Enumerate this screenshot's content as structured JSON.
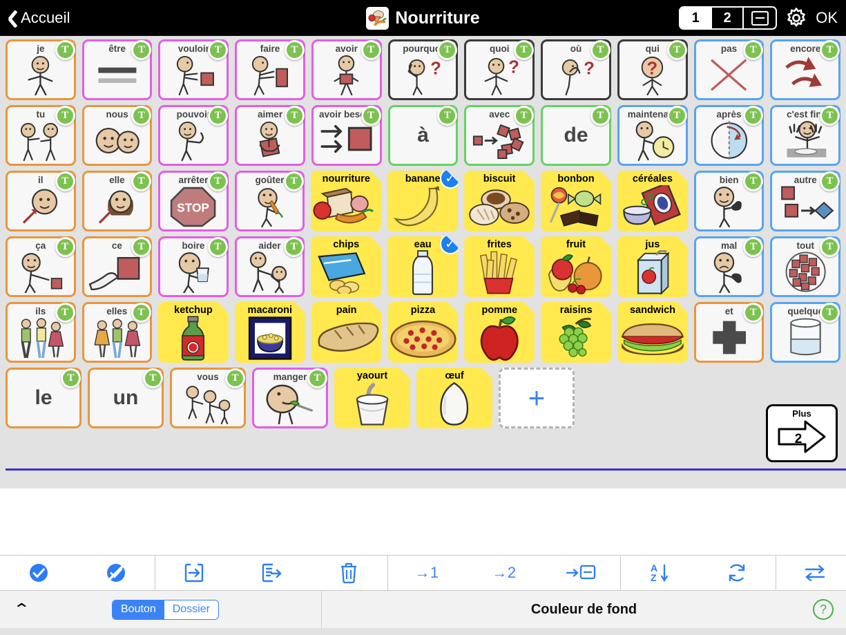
{
  "header": {
    "back_label": "Accueil",
    "title": "Nourriture",
    "title_icon": "food-basket-icon",
    "segments": [
      {
        "label": "1",
        "selected": true
      },
      {
        "label": "2",
        "selected": false
      },
      {
        "label": "tray-icon",
        "selected": false
      }
    ],
    "gear_icon": "gear-icon",
    "ok_label": "OK"
  },
  "grid": {
    "rows": [
      [
        {
          "label": "je",
          "style": "orange",
          "badge": "T",
          "art": "person-pointing-self"
        },
        {
          "label": "être",
          "style": "magenta",
          "badge": "T",
          "art": "equals-bars"
        },
        {
          "label": "vouloir",
          "style": "magenta",
          "badge": "T",
          "art": "person-reaching-square"
        },
        {
          "label": "faire",
          "style": "magenta",
          "badge": "T",
          "art": "person-making-square"
        },
        {
          "label": "avoir",
          "style": "magenta",
          "badge": "T",
          "art": "person-holding-square"
        },
        {
          "label": "pourquoi",
          "style": "dark",
          "badge": "T",
          "art": "person-thinking-question"
        },
        {
          "label": "quoi",
          "style": "dark",
          "badge": "T",
          "art": "person-shrug-question"
        },
        {
          "label": "où",
          "style": "dark",
          "badge": "T",
          "art": "person-looking-question"
        },
        {
          "label": "qui",
          "style": "dark",
          "badge": "T",
          "art": "person-question-head"
        },
        {
          "label": "pas",
          "style": "blue",
          "badge": "T",
          "art": "red-cross-x"
        },
        {
          "label": "encore",
          "style": "blue",
          "badge": "T",
          "art": "two-curved-arrows"
        }
      ],
      [
        {
          "label": "tu",
          "style": "orange",
          "badge": "T",
          "art": "two-people-pointing"
        },
        {
          "label": "nous",
          "style": "orange",
          "badge": "T",
          "art": "two-heads"
        },
        {
          "label": "pouvoir",
          "style": "magenta",
          "badge": "T",
          "art": "person-flexing"
        },
        {
          "label": "aimer",
          "style": "magenta",
          "badge": "T",
          "art": "person-hugging-square"
        },
        {
          "label": "avoir besoin",
          "style": "magenta",
          "badge": "T",
          "art": "hands-reaching-square"
        },
        {
          "label": "",
          "big": "à",
          "style": "green",
          "badge": "T",
          "art": ""
        },
        {
          "label": "avec",
          "style": "green",
          "badge": "T",
          "art": "squares-joining"
        },
        {
          "label": "",
          "big": "de",
          "style": "green",
          "badge": "T",
          "art": ""
        },
        {
          "label": "maintenant",
          "style": "blue",
          "badge": "T",
          "art": "person-with-clock"
        },
        {
          "label": "après",
          "style": "blue",
          "badge": "T",
          "art": "circle-half-arrow"
        },
        {
          "label": "c'est fini",
          "style": "blue",
          "badge": "T",
          "art": "person-empty-table"
        }
      ],
      [
        {
          "label": "il",
          "style": "orange",
          "badge": "T",
          "art": "boy-face-arrow"
        },
        {
          "label": "elle",
          "style": "orange",
          "badge": "T",
          "art": "girl-face-arrow"
        },
        {
          "label": "arrêter",
          "style": "magenta",
          "badge": "T",
          "art": "stop-sign"
        },
        {
          "label": "goûter",
          "style": "magenta",
          "badge": "T",
          "art": "person-tasting-carrot"
        },
        {
          "label": "nourriture",
          "style": "food",
          "art": "bread-apple-carrot-ham"
        },
        {
          "label": "banane",
          "style": "food",
          "badge": "check",
          "art": "banana"
        },
        {
          "label": "biscuit",
          "style": "food",
          "art": "cookies"
        },
        {
          "label": "bonbon",
          "style": "food",
          "art": "candy-lollipop-chocolate"
        },
        {
          "label": "céréales",
          "style": "food",
          "art": "cereal-box-bowl"
        },
        {
          "label": "bien",
          "style": "blue",
          "badge": "T",
          "art": "person-thumbs-up"
        },
        {
          "label": "autre",
          "style": "blue",
          "badge": "T",
          "art": "squares-to-diamond"
        }
      ],
      [
        {
          "label": "ça",
          "style": "orange",
          "badge": "T",
          "art": "person-pointing-square"
        },
        {
          "label": "ce",
          "style": "orange",
          "badge": "T",
          "art": "hand-pointing-square"
        },
        {
          "label": "boire",
          "style": "magenta",
          "badge": "T",
          "art": "person-drinking-glass"
        },
        {
          "label": "aider",
          "style": "magenta",
          "badge": "T",
          "art": "person-helping"
        },
        {
          "label": "chips",
          "style": "food",
          "art": "chips-bag"
        },
        {
          "label": "eau",
          "style": "food",
          "badge": "check",
          "art": "water-bottle"
        },
        {
          "label": "frites",
          "style": "food",
          "art": "french-fries"
        },
        {
          "label": "fruit",
          "style": "food",
          "art": "mixed-fruit"
        },
        {
          "label": "jus",
          "style": "food",
          "art": "juice-box"
        },
        {
          "label": "mal",
          "style": "blue",
          "badge": "T",
          "art": "person-thumbs-down"
        },
        {
          "label": "tout",
          "style": "blue",
          "badge": "T",
          "art": "many-squares-circle"
        }
      ],
      [
        {
          "label": "ils",
          "style": "orange",
          "badge": "T",
          "art": "three-people-mixed"
        },
        {
          "label": "elles",
          "style": "orange",
          "badge": "T",
          "art": "three-women"
        },
        {
          "label": "ketchup",
          "style": "food",
          "art": "ketchup-bottle"
        },
        {
          "label": "macaroni",
          "style": "food",
          "art": "macaroni-bowl"
        },
        {
          "label": "pain",
          "style": "food",
          "art": "bread-loaf"
        },
        {
          "label": "pizza",
          "style": "food",
          "art": "pizza"
        },
        {
          "label": "pomme",
          "style": "food",
          "art": "apple"
        },
        {
          "label": "raisins",
          "style": "food",
          "art": "grapes"
        },
        {
          "label": "sandwich",
          "style": "food",
          "art": "sandwich"
        },
        {
          "label": "et",
          "style": "orange",
          "badge": "T",
          "art": "grey-plus"
        },
        {
          "label": "quelque",
          "style": "blue",
          "badge": "T",
          "art": "glass-partially-full"
        }
      ],
      [
        {
          "label": "",
          "big": "le",
          "style": "orange",
          "badge": "T",
          "art": ""
        },
        {
          "label": "",
          "big": "un",
          "style": "orange",
          "badge": "T",
          "art": ""
        },
        {
          "label": "vous",
          "style": "orange",
          "badge": "T",
          "art": "person-pointing-others"
        },
        {
          "label": "manger",
          "style": "magenta",
          "badge": "T",
          "art": "person-eating-fork"
        },
        {
          "label": "yaourt",
          "style": "food",
          "art": "yogurt-cup"
        },
        {
          "label": "œuf",
          "style": "food",
          "art": "egg"
        },
        {
          "label": "+",
          "style": "add",
          "art": "plus-icon"
        }
      ]
    ],
    "next_page": {
      "label": "Plus",
      "number": "2"
    }
  },
  "toolbar": {
    "groups": [
      [
        {
          "name": "select-all",
          "icon": "check-circle-icon",
          "label": ""
        },
        {
          "name": "deselect-all",
          "icon": "no-select-icon",
          "label": ""
        }
      ],
      [
        {
          "name": "import",
          "icon": "import-icon",
          "label": ""
        },
        {
          "name": "export",
          "icon": "export-icon",
          "label": ""
        },
        {
          "name": "delete",
          "icon": "trash-icon",
          "label": ""
        }
      ],
      [
        {
          "name": "move-to-1",
          "icon": "arrow-to-1-icon",
          "label": "→1"
        },
        {
          "name": "move-to-2",
          "icon": "arrow-to-2-icon",
          "label": "→2"
        },
        {
          "name": "move-to-tray",
          "icon": "arrow-to-tray-icon",
          "label": ""
        }
      ],
      [
        {
          "name": "sort-alpha",
          "icon": "sort-az-icon",
          "label": ""
        },
        {
          "name": "refresh",
          "icon": "refresh-icon",
          "label": ""
        }
      ],
      [
        {
          "name": "swap",
          "icon": "swap-arrows-icon",
          "label": ""
        }
      ]
    ]
  },
  "bottom": {
    "collapse_icon": "chevron-up-icon",
    "mode_segments": [
      {
        "label": "Bouton",
        "selected": true
      },
      {
        "label": "Dossier",
        "selected": false
      }
    ],
    "panel_title": "Couleur de fond",
    "help_icon": "question-circle-icon"
  },
  "colors": {
    "accent": "#3b82f6",
    "pronoun_border": "#e8963c",
    "verb_border": "#e45de4",
    "question_border": "#3a3a3a",
    "preposition_border": "#62d462",
    "descriptor_border": "#56a5f0",
    "noun_border": "#ffe94f",
    "noun_fill": "#fdfae0",
    "badge_green": "#7cc24f",
    "selected_blue": "#1c7ff2",
    "rule_purple": "#3a2fd0",
    "help_green": "#4cae4c"
  }
}
